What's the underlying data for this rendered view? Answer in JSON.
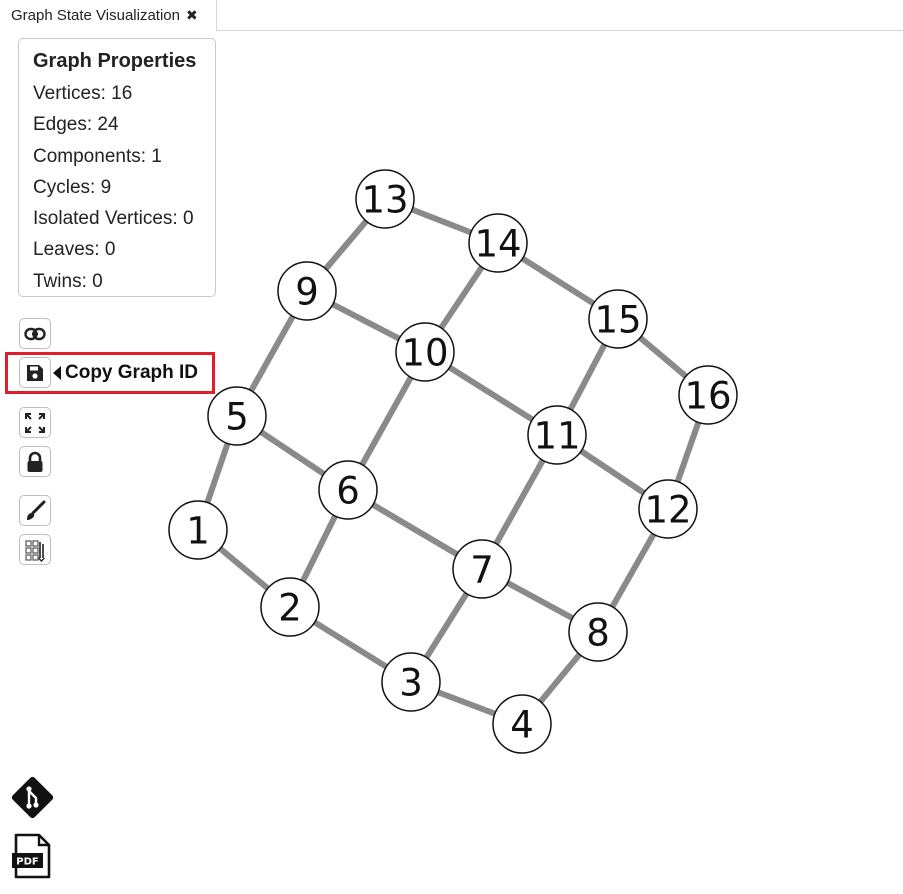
{
  "tab": {
    "title": "Graph State Visualization"
  },
  "properties": {
    "title": "Graph Properties",
    "rows": [
      "Vertices: 16",
      "Edges: 24",
      "Components: 1",
      "Cycles: 9",
      "Isolated Vertices: 0",
      "Leaves: 0",
      "Twins: 0"
    ]
  },
  "toolbar": {
    "buttons": [
      "link-icon",
      "save-icon",
      "fullscreen-icon",
      "lock-icon",
      "brush-icon",
      "grid-edit-icon"
    ],
    "tooltip": "Copy Graph ID"
  },
  "bottom_icons": [
    "git-icon",
    "pdf-icon"
  ],
  "graph": {
    "vertices": [
      "1",
      "2",
      "3",
      "4",
      "5",
      "6",
      "7",
      "8",
      "9",
      "10",
      "11",
      "12",
      "13",
      "14",
      "15",
      "16"
    ],
    "edges": [
      [
        "1",
        "2"
      ],
      [
        "2",
        "3"
      ],
      [
        "3",
        "4"
      ],
      [
        "5",
        "6"
      ],
      [
        "6",
        "7"
      ],
      [
        "7",
        "8"
      ],
      [
        "9",
        "10"
      ],
      [
        "10",
        "11"
      ],
      [
        "11",
        "12"
      ],
      [
        "13",
        "14"
      ],
      [
        "14",
        "15"
      ],
      [
        "15",
        "16"
      ],
      [
        "1",
        "5"
      ],
      [
        "5",
        "9"
      ],
      [
        "9",
        "13"
      ],
      [
        "2",
        "6"
      ],
      [
        "6",
        "10"
      ],
      [
        "10",
        "14"
      ],
      [
        "3",
        "7"
      ],
      [
        "7",
        "11"
      ],
      [
        "11",
        "15"
      ],
      [
        "4",
        "8"
      ],
      [
        "8",
        "12"
      ],
      [
        "12",
        "16"
      ]
    ]
  }
}
